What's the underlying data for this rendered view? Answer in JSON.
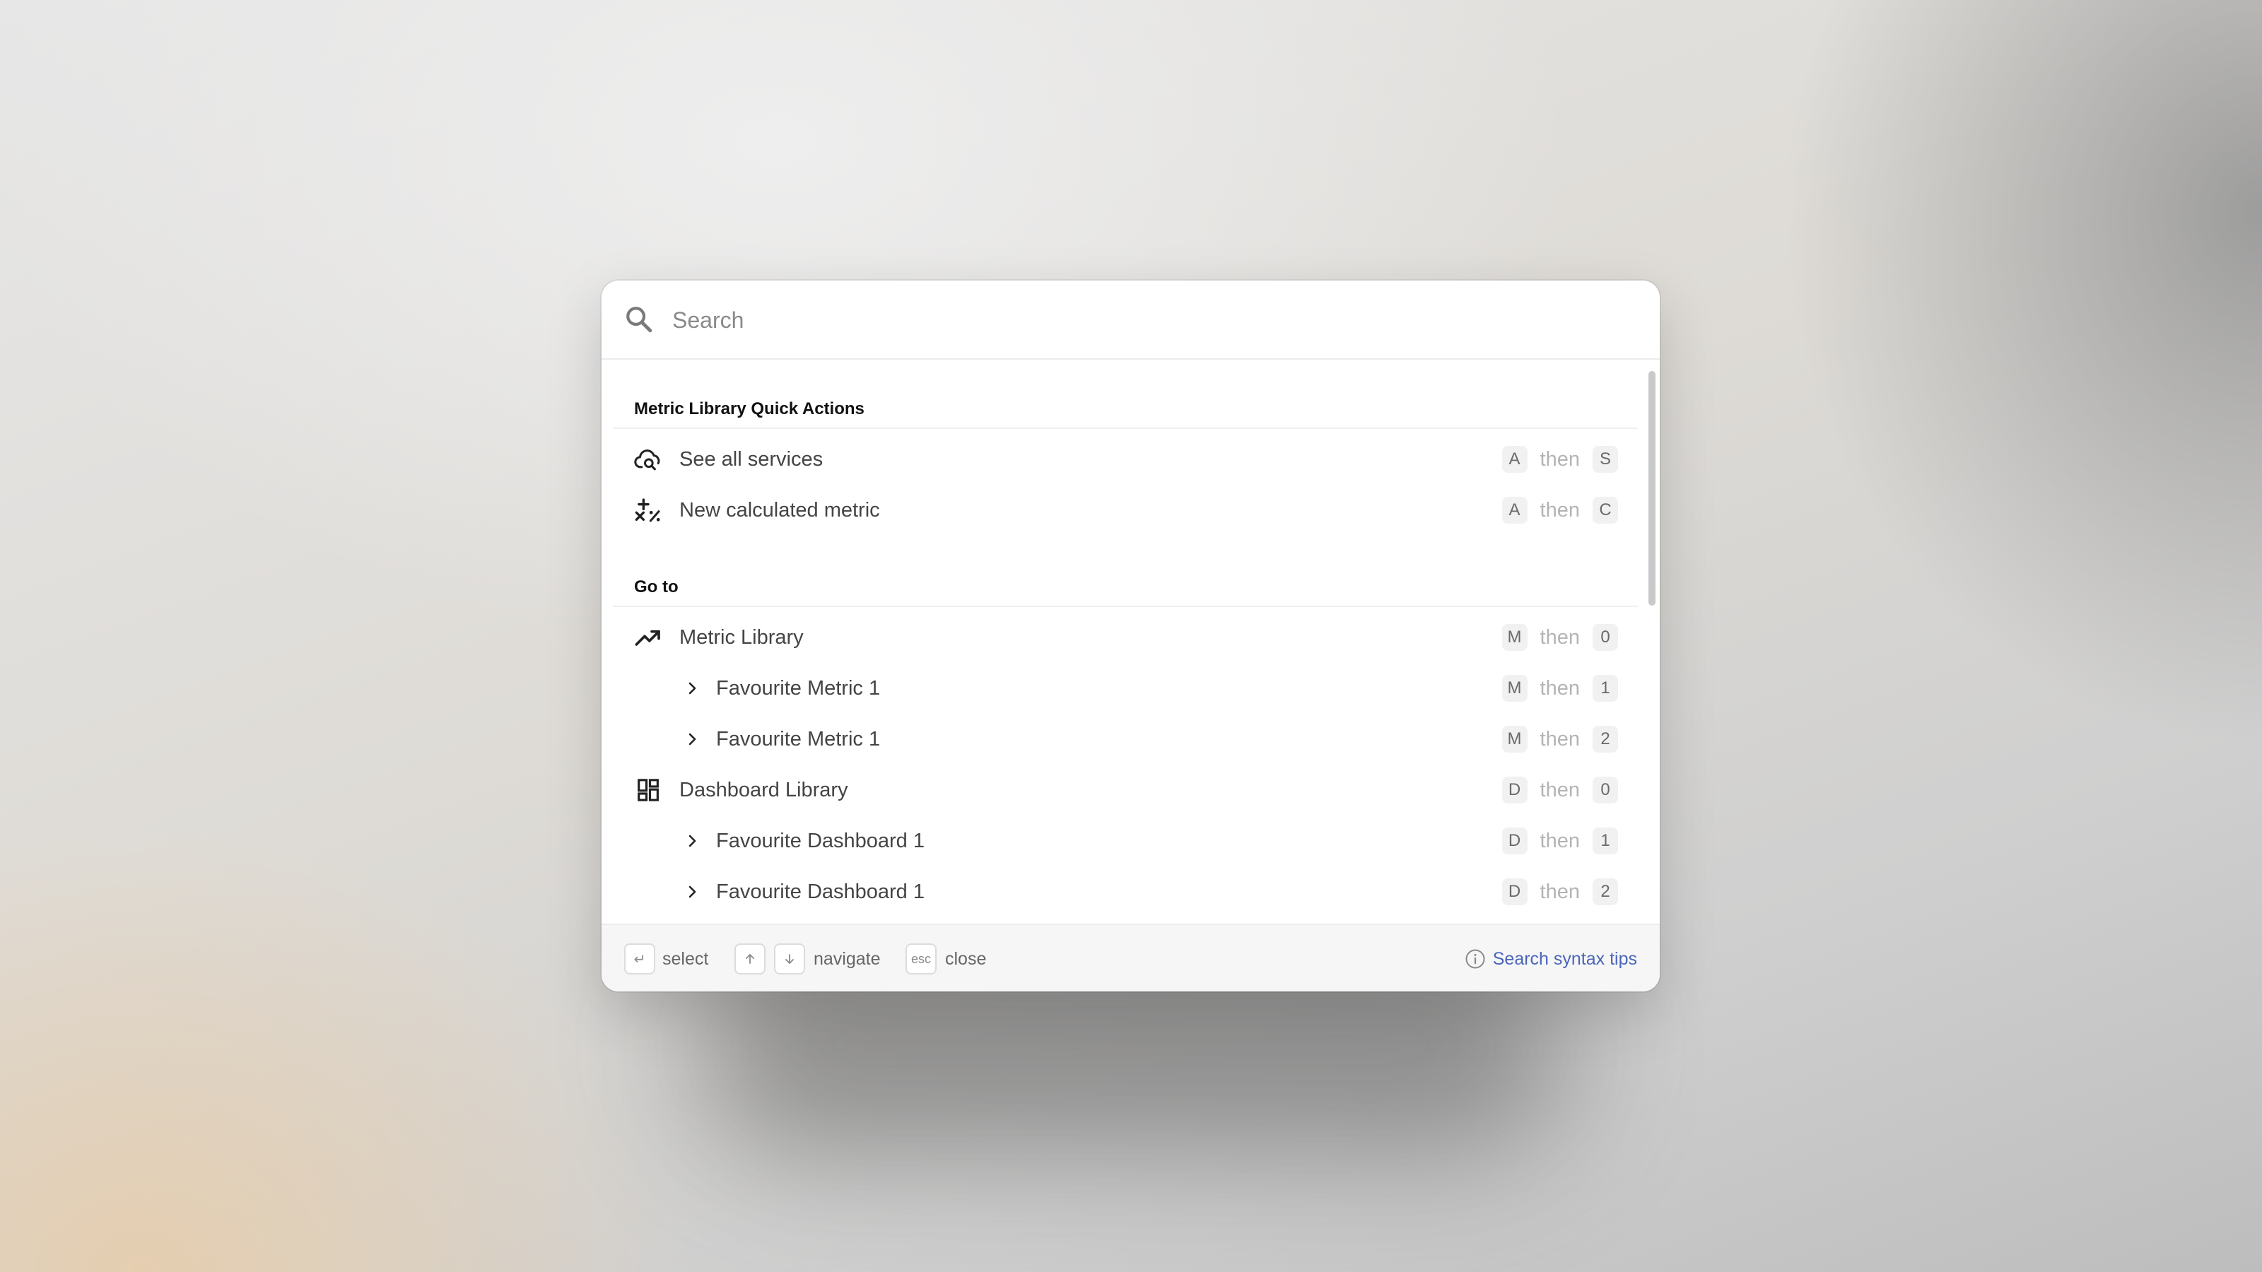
{
  "search": {
    "placeholder": "Search",
    "value": ""
  },
  "sections": [
    {
      "header": "Metric Library Quick Actions",
      "items": [
        {
          "label": "See all services",
          "icon": "cloud-search-icon",
          "level": "top",
          "shortcut": {
            "first": "A",
            "then": "then",
            "second": "S"
          }
        },
        {
          "label": "New calculated metric",
          "icon": "calculator-operators-icon",
          "level": "top",
          "shortcut": {
            "first": "A",
            "then": "then",
            "second": "C"
          }
        }
      ]
    },
    {
      "header": "Go to",
      "items": [
        {
          "label": "Metric Library",
          "icon": "trending-up-icon",
          "level": "top",
          "shortcut": {
            "first": "M",
            "then": "then",
            "second": "0"
          }
        },
        {
          "label": "Favourite Metric 1",
          "icon": "chevron-right-icon",
          "level": "sub",
          "shortcut": {
            "first": "M",
            "then": "then",
            "second": "1"
          }
        },
        {
          "label": "Favourite Metric 1",
          "icon": "chevron-right-icon",
          "level": "sub",
          "shortcut": {
            "first": "M",
            "then": "then",
            "second": "2"
          }
        },
        {
          "label": "Dashboard Library",
          "icon": "dashboard-grid-icon",
          "level": "top",
          "shortcut": {
            "first": "D",
            "then": "then",
            "second": "0"
          }
        },
        {
          "label": "Favourite Dashboard 1",
          "icon": "chevron-right-icon",
          "level": "sub",
          "shortcut": {
            "first": "D",
            "then": "then",
            "second": "1"
          }
        },
        {
          "label": "Favourite Dashboard 1",
          "icon": "chevron-right-icon",
          "level": "sub",
          "shortcut": {
            "first": "D",
            "then": "then",
            "second": "2"
          }
        }
      ]
    }
  ],
  "footer": {
    "select_key": "↵",
    "select_label": "select",
    "up_key_icon": "arrow-up-icon",
    "down_key_icon": "arrow-down-icon",
    "navigate_label": "navigate",
    "esc_key": "esc",
    "close_label": "close",
    "tips_icon": "info-icon",
    "tips_link": "Search syntax tips"
  },
  "colors": {
    "link": "#4a66b8",
    "section_header": "#111111",
    "item_text": "#444444",
    "key_background": "#f1f1f1"
  }
}
